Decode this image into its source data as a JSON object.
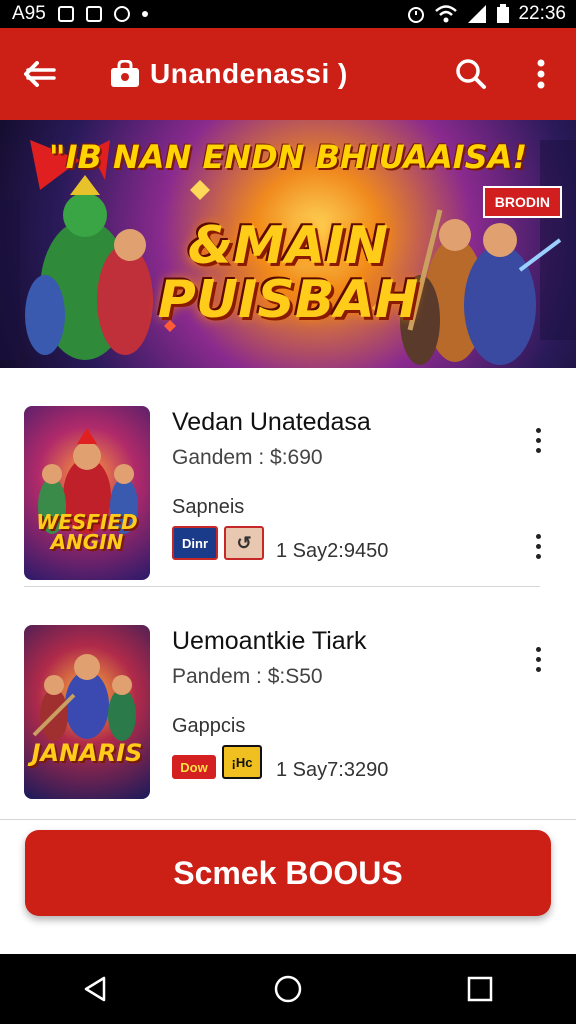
{
  "status_bar": {
    "carrier": "A95",
    "time": "22:36"
  },
  "app_bar": {
    "title": "Unandenassi )"
  },
  "banner": {
    "headline": "\"IB NAN ENDN BHIUAAISA!",
    "badge": "BRODIN",
    "logo_line1": "&MAIN",
    "logo_line2": "PUISBAH"
  },
  "items": [
    {
      "name": "Vedan Unatedasa",
      "price": "Gandem : $:690",
      "category": "Sapneis",
      "tag1": "Dinr",
      "tag2": "↺",
      "date": "1 Say2:9450",
      "thumb_line1": "WESFIED",
      "thumb_line2": "ANGIN"
    },
    {
      "name": "Uemoantkie Tiark",
      "price": "Pandem : $:S50",
      "category": "Gappcis",
      "tag1": "Dow",
      "tag2": "¡Hc",
      "date": "1 Say7:3290",
      "thumb_line1": "JANARIS",
      "thumb_line2": ""
    }
  ],
  "cta": {
    "label": "Scmek BOOUS"
  },
  "colors": {
    "primary": "#cc1f16",
    "status_bar": "#000000",
    "nav_bar": "#000000"
  },
  "icons": {
    "back": "arrow-left-icon",
    "search": "search-icon",
    "more": "more-vert-icon",
    "nav_back": "triangle-back-icon",
    "nav_home": "circle-home-icon",
    "nav_recents": "square-recents-icon"
  }
}
